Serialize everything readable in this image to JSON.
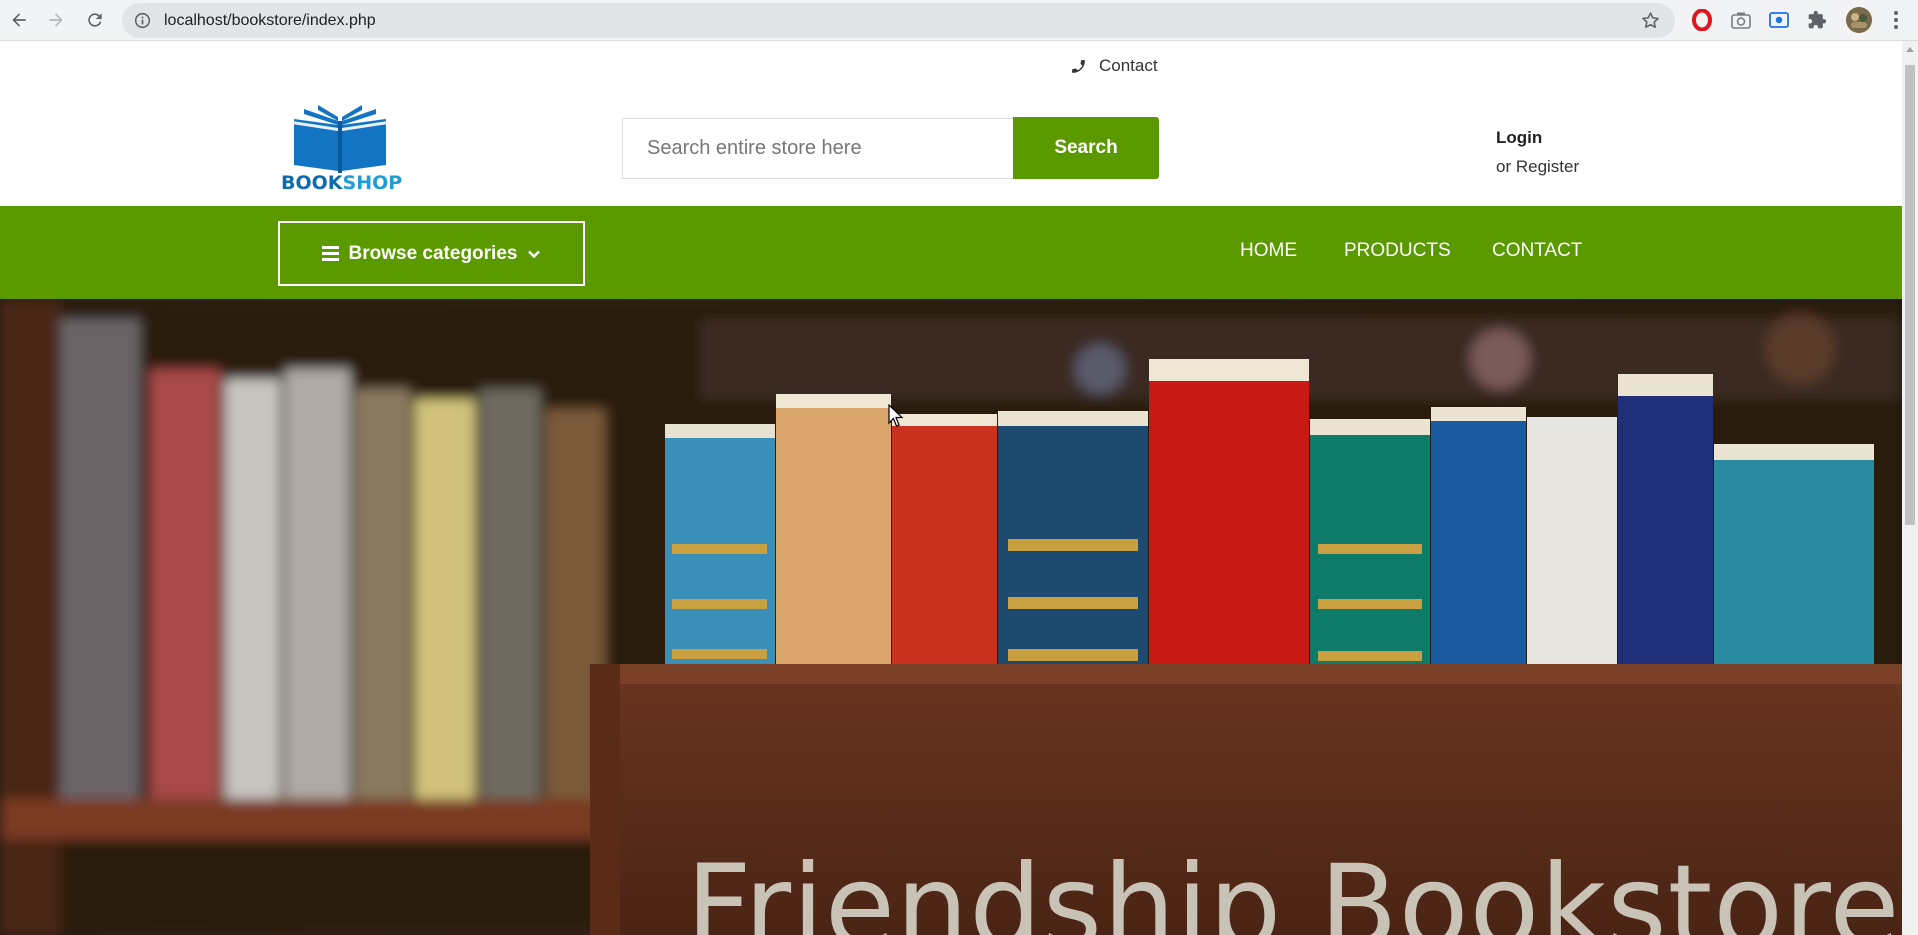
{
  "browser": {
    "url": "localhost/bookstore/index.php"
  },
  "header": {
    "contact_label": "Contact",
    "logo": {
      "part1": "BOOK",
      "part2": "SHOP"
    },
    "search": {
      "placeholder": "Search entire store here",
      "button_label": "Search"
    },
    "account": {
      "login_label": "Login",
      "register_label": "or Register"
    }
  },
  "navbar": {
    "browse_label": "Browse categories",
    "menu": [
      {
        "label": "HOME"
      },
      {
        "label": "PRODUCTS"
      },
      {
        "label": "CONTACT"
      }
    ]
  },
  "hero": {
    "title": "Friendship Bookstore"
  },
  "colors": {
    "brand_green": "#5a9a00",
    "logo_dark_blue": "#0c6bb3",
    "logo_light_blue": "#1e9ed8"
  },
  "icons": [
    "back-icon",
    "forward-icon",
    "reload-icon",
    "info-icon",
    "star-icon",
    "opera-icon",
    "camera-icon",
    "screen-capture-icon",
    "puzzle-icon",
    "profile-avatar-icon",
    "more-vert-icon",
    "phone-icon",
    "book-logo-icon",
    "menu-bars-icon",
    "chevron-down-icon"
  ]
}
